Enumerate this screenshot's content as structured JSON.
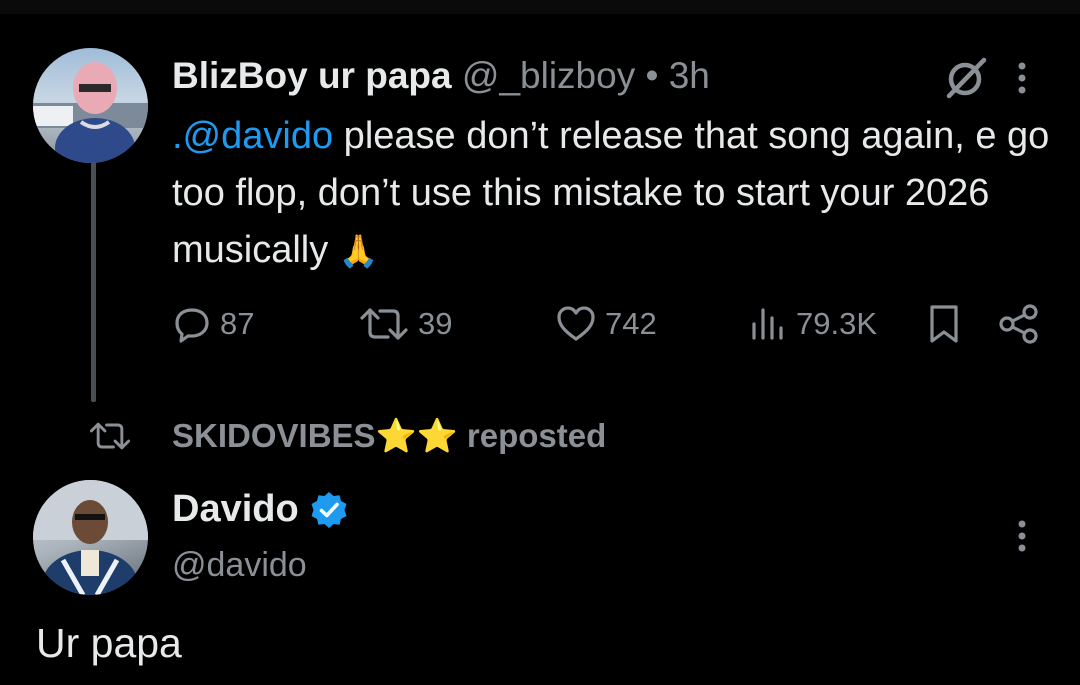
{
  "tweet1": {
    "display_name": "BlizBoy ur papa",
    "handle": "@_blizboy",
    "separator": "•",
    "time": "3h",
    "mention": ".@davido",
    "text_rest": " please don’t release that song again, e go too flop, don’t use this mistake to start your 2026 musically ",
    "emoji": "🙏",
    "stats": {
      "replies": "87",
      "reposts": "39",
      "likes": "742",
      "views": "79.3K"
    }
  },
  "repost_banner": {
    "user": "SKIDOVIBES",
    "stars": "⭐⭐",
    "label": "reposted"
  },
  "tweet2": {
    "display_name": "Davido",
    "handle": "@davido",
    "text": "Ur papa"
  },
  "colors": {
    "background": "#000000",
    "text": "#e7e9ea",
    "muted": "#8b9096",
    "accent": "#1d9bf0"
  },
  "icons": [
    "grok-icon",
    "more-icon",
    "reply-icon",
    "repost-icon",
    "like-icon",
    "views-icon",
    "bookmark-icon",
    "share-icon",
    "verified-icon"
  ]
}
